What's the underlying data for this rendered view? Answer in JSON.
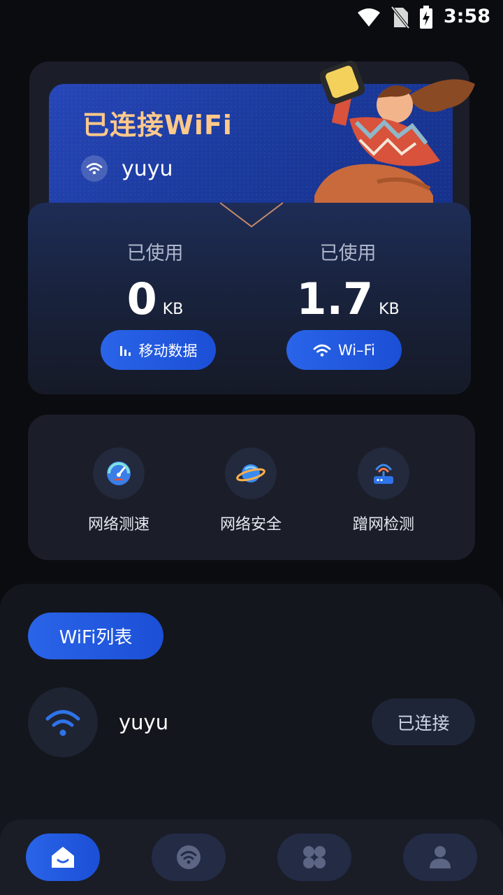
{
  "status_bar": {
    "time": "3:58",
    "icons": [
      "wifi-signal-icon",
      "no-sim-icon",
      "battery-charging-icon"
    ]
  },
  "header_card": {
    "title": "已连接WiFi",
    "ssid": "yuyu",
    "ssid_icon": "wifi-icon"
  },
  "usage": {
    "mobile": {
      "label": "已使用",
      "value": "0",
      "unit": "KB",
      "button_label": "移动数据",
      "button_icon": "signal-bars-icon"
    },
    "wifi": {
      "label": "已使用",
      "value": "1.7",
      "unit": "KB",
      "button_label": "Wi–Fi",
      "button_icon": "wifi-icon"
    }
  },
  "tools": [
    {
      "label": "网络测速",
      "icon": "speedometer-icon"
    },
    {
      "label": "网络安全",
      "icon": "planet-shield-icon"
    },
    {
      "label": "蹭网检测",
      "icon": "router-icon"
    }
  ],
  "wifi_list": {
    "tab_label": "WiFi列表",
    "networks": [
      {
        "name": "yuyu",
        "status": "已连接",
        "icon": "wifi-icon"
      }
    ]
  },
  "bottom_nav": {
    "items": [
      {
        "icon": "home-icon",
        "active": true
      },
      {
        "icon": "wifi-icon",
        "active": false
      },
      {
        "icon": "apps-grid-icon",
        "active": false
      },
      {
        "icon": "user-icon",
        "active": false
      }
    ]
  },
  "colors": {
    "background": "#0b0c10",
    "card": "#1b1e29",
    "accent_blue": "#2a64e8",
    "title_orange": "#ffc98a"
  }
}
